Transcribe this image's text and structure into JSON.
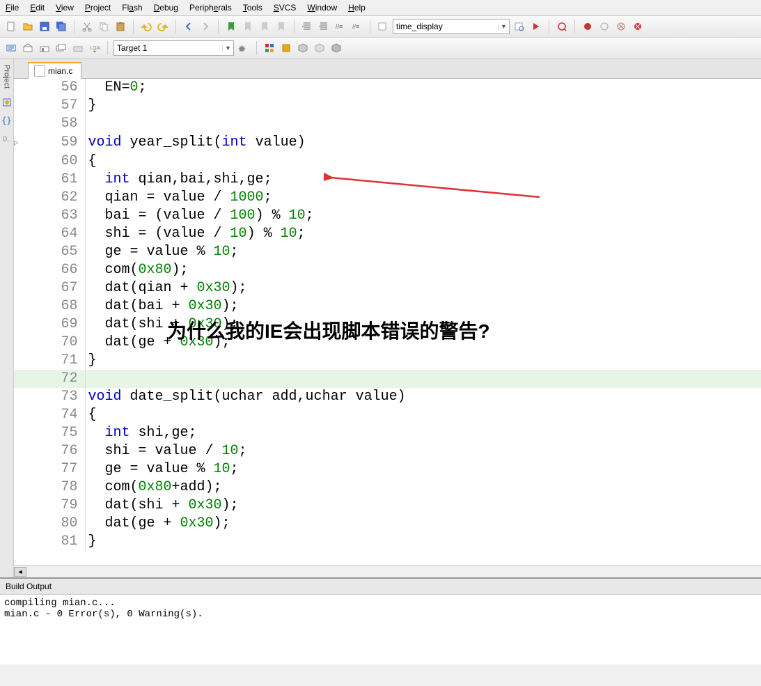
{
  "menu": {
    "file": "File",
    "edit": "Edit",
    "view": "View",
    "project": "Project",
    "flash": "Flash",
    "debug": "Debug",
    "peripherals": "Peripherals",
    "tools": "Tools",
    "svcs": "SVCS",
    "window": "Window",
    "help": "Help"
  },
  "toolbar1": {
    "searchbox": "time_display"
  },
  "toolbar2": {
    "target": "Target 1"
  },
  "sidebar": {
    "project_tab": "Project"
  },
  "tabs": {
    "file": "mian.c"
  },
  "code": {
    "start": 56,
    "highlight": 72,
    "lines": [
      {
        "n": 56,
        "t": "  EN=",
        "hl": [
          {
            "k": "num",
            "v": "0"
          }
        ],
        "s": ";"
      },
      {
        "n": 57,
        "t": "}"
      },
      {
        "n": 58,
        "t": ""
      },
      {
        "n": 59,
        "pre": "",
        "kw": "void",
        "mid": " year_split(",
        "kw2": "int",
        "tail": " value)",
        "mark": true
      },
      {
        "n": 60,
        "t": "{"
      },
      {
        "n": 61,
        "pre": "  ",
        "kw": "int",
        "tail": " qian,bai,shi,ge;"
      },
      {
        "n": 62,
        "t": "  qian = value / ",
        "num": "1000",
        "s": ";"
      },
      {
        "n": 63,
        "t": "  bai = (value / ",
        "num": "100",
        "mid2": ") % ",
        "num2": "10",
        "s": ";"
      },
      {
        "n": 64,
        "t": "  shi = (value / ",
        "num": "10",
        "mid2": ") % ",
        "num2": "10",
        "s": ";"
      },
      {
        "n": 65,
        "t": "  ge = value % ",
        "num": "10",
        "s": ";"
      },
      {
        "n": 66,
        "t": "  com(",
        "num": "0x80",
        "s": ");"
      },
      {
        "n": 67,
        "t": "  dat(qian + ",
        "num": "0x30",
        "s": ");"
      },
      {
        "n": 68,
        "t": "  dat(bai + ",
        "num": "0x30",
        "s": ");"
      },
      {
        "n": 69,
        "t": "  dat(shi + ",
        "num": "0x30",
        "s": ");"
      },
      {
        "n": 70,
        "t": "  dat(ge + ",
        "num": "0x30",
        "s": ");"
      },
      {
        "n": 71,
        "t": "}"
      },
      {
        "n": 72,
        "t": ""
      },
      {
        "n": 73,
        "pre": "",
        "kw": "void",
        "tail": " date_split(uchar add,uchar value)"
      },
      {
        "n": 74,
        "t": "{"
      },
      {
        "n": 75,
        "pre": "  ",
        "kw": "int",
        "tail": " shi,ge;"
      },
      {
        "n": 76,
        "t": "  shi = value / ",
        "num": "10",
        "s": ";"
      },
      {
        "n": 77,
        "t": "  ge = value % ",
        "num": "10",
        "s": ";"
      },
      {
        "n": 78,
        "t": "  com(",
        "num": "0x80",
        "mid2": "+add",
        "s": ");"
      },
      {
        "n": 79,
        "t": "  dat(shi + ",
        "num": "0x30",
        "s": ");"
      },
      {
        "n": 80,
        "t": "  dat(ge + ",
        "num": "0x30",
        "s": ");"
      },
      {
        "n": 81,
        "t": "}"
      }
    ]
  },
  "overlay": "为什么我的IE会出现脚本错误的警告?",
  "output": {
    "title": "Build Output",
    "lines": [
      "compiling mian.c...",
      "mian.c - 0 Error(s), 0 Warning(s)."
    ]
  }
}
